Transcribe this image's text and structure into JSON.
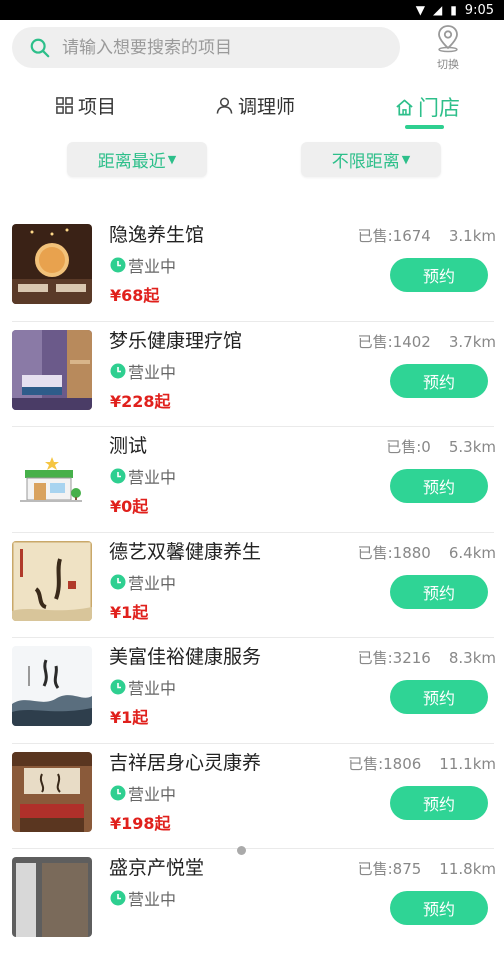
{
  "statusbar": {
    "time": "9:05"
  },
  "search": {
    "placeholder": "请输入想要搜索的项目",
    "switch_label": "切换"
  },
  "tabs": [
    {
      "label": "项目",
      "icon": "grid-icon"
    },
    {
      "label": "调理师",
      "icon": "person-icon"
    },
    {
      "label": "门店",
      "icon": "home-icon",
      "active": true
    }
  ],
  "filters": {
    "distance_sort": "距离最近",
    "distance_range": "不限距离"
  },
  "colors": {
    "accent": "#2ecf90",
    "price": "#e0201c"
  },
  "stores": [
    {
      "name": "隐逸养生馆",
      "status": "营业中",
      "price": "¥68起",
      "sold": "已售:1674",
      "distance": "3.1km",
      "book": "预约"
    },
    {
      "name": "梦乐健康理疗馆",
      "status": "营业中",
      "price": "¥228起",
      "sold": "已售:1402",
      "distance": "3.7km",
      "book": "预约"
    },
    {
      "name": "测试",
      "status": "营业中",
      "price": "¥0起",
      "sold": "已售:0",
      "distance": "5.3km",
      "book": "预约"
    },
    {
      "name": "德艺双馨健康养生",
      "status": "营业中",
      "price": "¥1起",
      "sold": "已售:1880",
      "distance": "6.4km",
      "book": "预约"
    },
    {
      "name": "美富佳裕健康服务",
      "status": "营业中",
      "price": "¥1起",
      "sold": "已售:3216",
      "distance": "8.3km",
      "book": "预约"
    },
    {
      "name": "吉祥居身心灵康养",
      "status": "营业中",
      "price": "¥198起",
      "sold": "已售:1806",
      "distance": "11.1km",
      "book": "预约"
    },
    {
      "name": "盛京产悦堂",
      "status": "营业中",
      "price": "",
      "sold": "已售:875",
      "distance": "11.8km",
      "book": "预约"
    }
  ]
}
